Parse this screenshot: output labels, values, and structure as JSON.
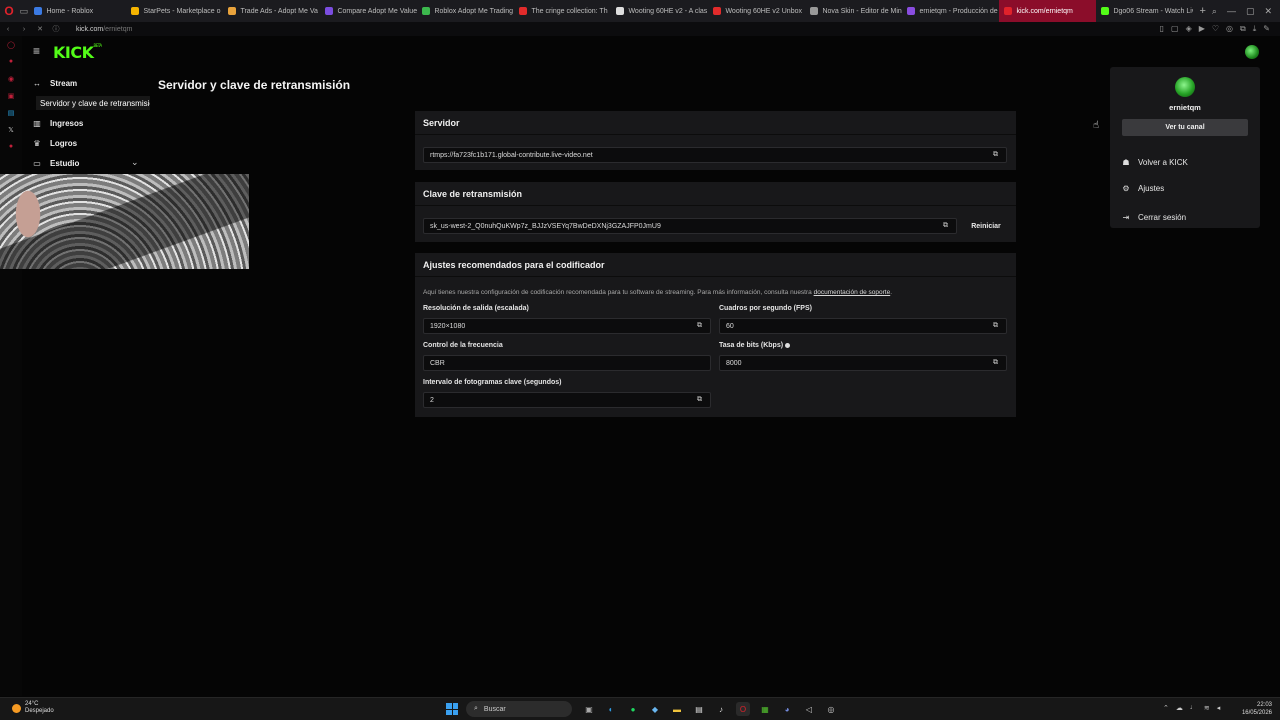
{
  "browser": {
    "tabs": [
      {
        "title": "Home - Roblox",
        "color": "#3b7ae3"
      },
      {
        "title": "StarPets - Marketplace o",
        "color": "#f5b400"
      },
      {
        "title": "Trade Ads - Adopt Me Va",
        "color": "#e9a33c"
      },
      {
        "title": "Compare Adopt Me Value",
        "color": "#7b4de0"
      },
      {
        "title": "Roblox Adopt Me Trading",
        "color": "#3cb84d"
      },
      {
        "title": "The cringe collection: Th",
        "color": "#e22b2b"
      },
      {
        "title": "Wooting 60HE v2 - A clas",
        "color": "#dddddd"
      },
      {
        "title": "Wooting 60HE v2 Unbox",
        "color": "#e22b2b"
      },
      {
        "title": "Nova Skin - Editor de Min",
        "color": "#999999"
      },
      {
        "title": "ernietqm - Producción de",
        "color": "#8a4de0"
      },
      {
        "title": "kick.com/ernietqm",
        "color": "#e0222b",
        "active": true
      },
      {
        "title": "Dgo06 Stream - Watch Liv",
        "color": "#53fc18"
      }
    ],
    "address": {
      "domain": "kick.com",
      "path": "/ernietqm"
    },
    "new_tab": "+"
  },
  "kick": {
    "logo": "KICK",
    "logo_beta": "BETA",
    "page_title": "Servidor y clave de retransmisión",
    "sidebar": {
      "stream": "Stream",
      "active_sub": "Servidor y clave de retransmisión",
      "ingresos": "Ingresos",
      "logros": "Logros",
      "estudio": "Estudio"
    },
    "server_panel": {
      "title": "Servidor",
      "value": "rtmps://fa723fc1b171.global-contribute.live-video.net"
    },
    "key_panel": {
      "title": "Clave de retransmisión",
      "value": "sk_us-west-2_Q0nuhQuKWp7z_BJJzVSEYq7BwDeDXNj3GZAJFP0JmU9",
      "reset": "Reiniciar"
    },
    "encoder_panel": {
      "title": "Ajustes recomendados para el codificador",
      "desc": "Aquí tienes nuestra configuración de codificación recomendada para tu software de streaming. Para más información, consulta nuestra",
      "desc_link": "documentación de soporte",
      "desc_end": ".",
      "resolution_label": "Resolución de salida (escalada)",
      "resolution_value": "1920×1080",
      "fps_label": "Cuadros por segundo (FPS)",
      "fps_value": "60",
      "rate_control_label": "Control de la frecuencia",
      "rate_control_value": "CBR",
      "bitrate_label": "Tasa de bits (Kbps)",
      "bitrate_value": "8000",
      "keyframe_label": "Intervalo de fotogramas clave (segundos)",
      "keyframe_value": "2"
    },
    "user_menu": {
      "username": "ernietqm",
      "view_channel": "Ver tu canal",
      "back_to_kick": "Volver a KICK",
      "settings": "Ajustes",
      "logout": "Cerrar sesión"
    }
  },
  "taskbar": {
    "temperature": "24°C",
    "weather": "Despejado",
    "search_placeholder": "Buscar",
    "time": "22:03",
    "date": "16/05/2026"
  }
}
